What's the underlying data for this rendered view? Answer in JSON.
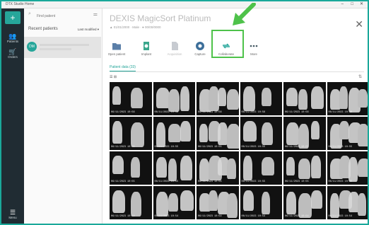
{
  "window": {
    "app_title": "DTX Studio Home"
  },
  "rail": {
    "add_label": "+",
    "items": [
      {
        "label": "Patients",
        "icon": "people-icon"
      },
      {
        "label": "Orders",
        "icon": "cart-icon"
      }
    ],
    "menu_label": "Menu"
  },
  "patients_panel": {
    "search_placeholder": "Find patient",
    "recent_title": "Recent patients",
    "sort_label": "Last modified ▾",
    "avatar_initials": "DM"
  },
  "patient": {
    "title": "DEXIS MagicSort Platinum",
    "subtitle": "▲ 01/01/2000 · Male · ● 00/00/0000"
  },
  "actions": [
    {
      "label": "Open patient",
      "icon": "folder-icon",
      "color": "#5b7fa8"
    },
    {
      "label": "Implant",
      "icon": "implant-icon",
      "color": "#3aa68c"
    },
    {
      "label": "Acquisition",
      "icon": "document-icon",
      "color": "#c7cbd1"
    },
    {
      "label": "Capture",
      "icon": "capture-icon",
      "color": "#3d6f9a"
    },
    {
      "label": "Collaborate",
      "icon": "collaborate-icon",
      "color": "#26a69a"
    },
    {
      "label": "More",
      "icon": "more-icon",
      "color": "#455a64"
    }
  ],
  "tab": {
    "label": "Patient data (33)"
  },
  "xray_dates": [
    "06/11/2023 10:56",
    "06/11/2023 10:56",
    "06/11/2023 10:56",
    "06/11/2023 10:56",
    "06/11/2023 10:56",
    "06/11/2023 10:56",
    "06/11/2023 10:55",
    "06/11/2023 10:55",
    "06/11/2023 10:55",
    "06/11/2023 10:55",
    "06/11/2023 10:55",
    "06/11/2023 10:55",
    "06/11/2023 10:55",
    "06/11/2023 10:55",
    "06/11/2023 10:55",
    "06/11/2023 10:55",
    "06/11/2023 10:55",
    "06/11/2023 10:55",
    "06/11/2023 10:54",
    "06/11/2023 10:54",
    "06/11/2023 10:54",
    "06/11/2023 10:54",
    "06/11/2023 10:54",
    "06/11/2023 10:54"
  ],
  "colors": {
    "accent": "#26a69a",
    "highlight": "#4ec24a",
    "rail": "#202c33"
  }
}
